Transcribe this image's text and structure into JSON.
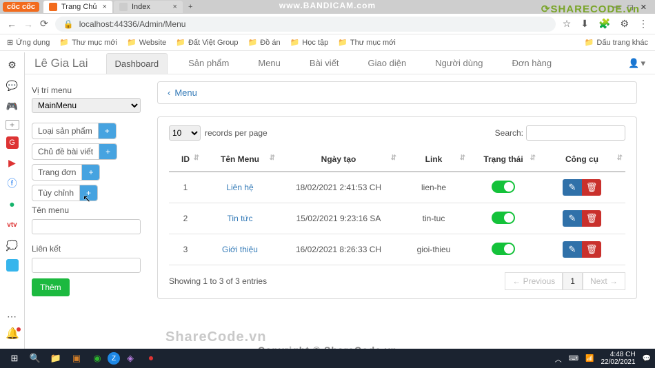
{
  "browser": {
    "tabs": [
      {
        "title": "Trang Chủ",
        "favicon": "#f26b1d"
      },
      {
        "title": "Index",
        "favicon": "#ccc"
      }
    ],
    "url": "localhost:44336/Admin/Menu",
    "bookmarks": [
      "Ứng dụng",
      "Thư mục mới",
      "Website",
      "Đất Việt Group",
      "Đồ án",
      "Học tập",
      "Thư mục mới"
    ],
    "bookmarks_overflow": "Dấu trang khác",
    "coccoc": "cốc cốc"
  },
  "overlay": {
    "bandicam": "www.BANDICAM.com",
    "sharecode": "SHARECODE.vn",
    "watermark1": "ShareCode.vn",
    "watermark2": "Copyright © ShareCode.vn"
  },
  "header": {
    "brand": "Lê Gia Lai",
    "tabs": [
      "Dashboard",
      "Sản phẩm",
      "Menu",
      "Bài viết",
      "Giao diện",
      "Người dùng",
      "Đơn hàng"
    ],
    "active_tab": "Dashboard"
  },
  "sidepanel": {
    "pos_label": "Vị trí menu",
    "pos_value": "MainMenu",
    "buttons": [
      "Loại sản phẩm",
      "Chủ đề bài viết",
      "Trang đơn",
      "Tùy chỉnh"
    ],
    "name_label": "Tên menu",
    "link_label": "Liên kết",
    "submit": "Thêm"
  },
  "breadcrumb": {
    "item": "Menu"
  },
  "table": {
    "records_label": "records per page",
    "records_value": "10",
    "search_label": "Search:",
    "columns": [
      "ID",
      "Tên Menu",
      "Ngày tạo",
      "Link",
      "Trạng thái",
      "Công cụ"
    ],
    "rows": [
      {
        "id": "1",
        "name": "Liên hệ",
        "date": "18/02/2021 2:41:53 CH",
        "link": "lien-he"
      },
      {
        "id": "2",
        "name": "Tin tức",
        "date": "15/02/2021 9:23:16 SA",
        "link": "tin-tuc"
      },
      {
        "id": "3",
        "name": "Giới thiệu",
        "date": "16/02/2021 8:26:33 CH",
        "link": "gioi-thieu"
      }
    ],
    "info": "Showing 1 to 3 of 3 entries",
    "prev": "← Previous",
    "page": "1",
    "next": "Next →"
  },
  "taskbar": {
    "time": "4:48 CH",
    "date": "22/02/2021"
  }
}
